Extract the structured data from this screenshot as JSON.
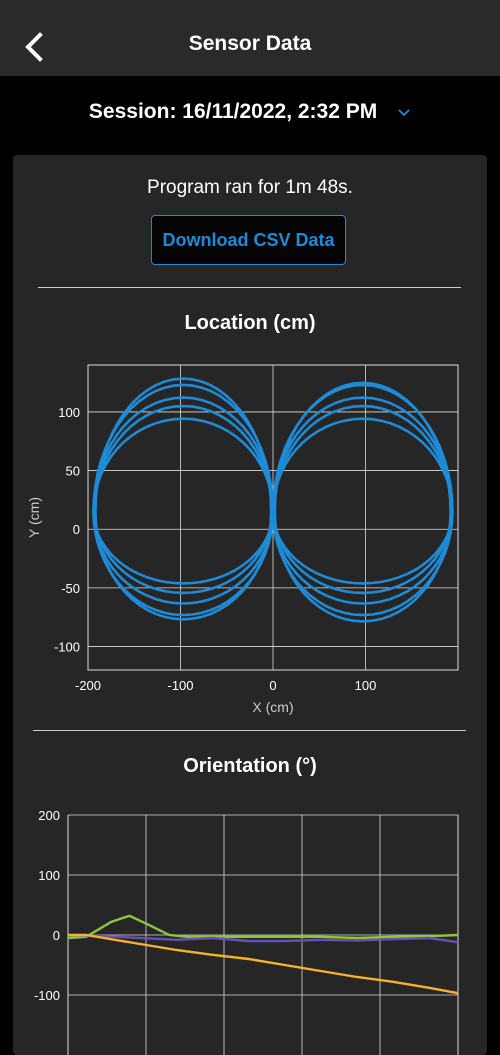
{
  "header": {
    "title": "Sensor Data",
    "back_icon": "chevron-left-icon"
  },
  "session": {
    "label": "Session: 16/11/2022, 2:32 PM",
    "dropdown_icon": "chevron-down-icon"
  },
  "summary": {
    "runtime_text": "Program ran for 1m 48s.",
    "download_label": "Download CSV Data"
  },
  "colors": {
    "accent": "#1f8bd6",
    "series_green": "#8cc63f",
    "series_purple": "#6a4fb0",
    "series_orange": "#f7b32b"
  },
  "chart_data": [
    {
      "type": "scatter",
      "title": "Location (cm)",
      "xlabel": "X (cm)",
      "ylabel": "Y (cm)",
      "xlim": [
        -200,
        200
      ],
      "ylim": [
        -120,
        140
      ],
      "xticks": [
        -200,
        -100,
        0,
        100
      ],
      "yticks": [
        -100,
        -50,
        0,
        50,
        100
      ],
      "grid": true,
      "series": [
        {
          "values_desc": "figure-eight path, loop 1",
          "loops": [
            {
              "cx": -97,
              "rx": 97,
              "top": 88,
              "bottom": -68
            },
            {
              "cx": 97,
              "rx": 97,
              "top": 88,
              "bottom": -68
            }
          ]
        },
        {
          "loops": [
            {
              "cx": -97,
              "rx": 96,
              "top": 100,
              "bottom": -77
            },
            {
              "cx": 97,
              "rx": 96,
              "top": 100,
              "bottom": -77
            }
          ]
        },
        {
          "loops": [
            {
              "cx": -97,
              "rx": 97,
              "top": 108,
              "bottom": -87
            },
            {
              "cx": 97,
              "rx": 97,
              "top": 108,
              "bottom": -87
            }
          ]
        },
        {
          "loops": [
            {
              "cx": -97,
              "rx": 97,
              "top": 120,
              "bottom": -98
            },
            {
              "cx": 97,
              "rx": 97,
              "top": 120,
              "bottom": -98
            }
          ]
        },
        {
          "loops": [
            {
              "cx": -97,
              "rx": 95,
              "top": 126,
              "bottom": -102
            },
            {
              "cx": 97,
              "rx": 95,
              "top": 122,
              "bottom": -104
            }
          ]
        }
      ]
    },
    {
      "type": "line",
      "title": "Orientation (°)",
      "ylim": [
        -100,
        200
      ],
      "yticks": [
        -100,
        0,
        100,
        200
      ],
      "xlim": [
        0,
        108
      ],
      "grid": true,
      "series": [
        {
          "color_key": "series_green",
          "x": [
            0,
            5,
            12,
            17,
            22,
            28,
            33,
            40,
            50,
            60,
            70,
            80,
            90,
            100,
            108
          ],
          "values": [
            -5,
            -3,
            22,
            32,
            18,
            0,
            -3,
            -3,
            -3,
            -3,
            -3,
            -5,
            -3,
            -2,
            0
          ]
        },
        {
          "color_key": "series_purple",
          "x": [
            0,
            10,
            20,
            30,
            40,
            50,
            60,
            70,
            80,
            90,
            100,
            108
          ],
          "values": [
            0,
            -2,
            -5,
            -8,
            -5,
            -10,
            -10,
            -8,
            -9,
            -7,
            -5,
            -12
          ]
        },
        {
          "color_key": "series_orange",
          "x": [
            0,
            5,
            10,
            20,
            30,
            40,
            50,
            60,
            70,
            80,
            90,
            100,
            108
          ],
          "values": [
            0,
            0,
            -5,
            -15,
            -25,
            -33,
            -40,
            -50,
            -60,
            -70,
            -78,
            -88,
            -97
          ]
        }
      ]
    }
  ]
}
